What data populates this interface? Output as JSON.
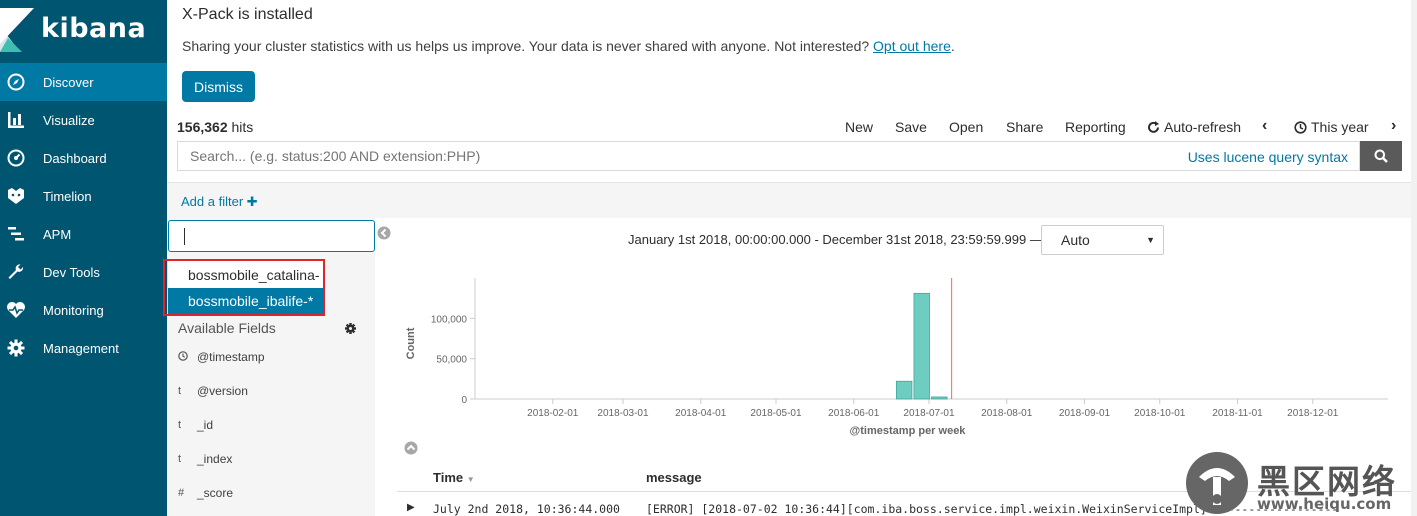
{
  "brand": {
    "name": "kibana"
  },
  "sidebar": {
    "items": [
      {
        "label": "Discover",
        "icon": "compass-icon",
        "active": true
      },
      {
        "label": "Visualize",
        "icon": "bar-chart-icon"
      },
      {
        "label": "Dashboard",
        "icon": "dashboard-icon"
      },
      {
        "label": "Timelion",
        "icon": "timelion-icon"
      },
      {
        "label": "APM",
        "icon": "apm-icon"
      },
      {
        "label": "Dev Tools",
        "icon": "wrench-icon"
      },
      {
        "label": "Monitoring",
        "icon": "heartbeat-icon"
      },
      {
        "label": "Management",
        "icon": "gear-icon"
      }
    ]
  },
  "banner": {
    "title": "X-Pack is installed",
    "text": "Sharing your cluster statistics with us helps us improve. Your data is never shared with anyone. Not interested?",
    "opt_out_link": "Opt out here",
    "text_end": ".",
    "dismiss_label": "Dismiss"
  },
  "hits": {
    "count": "156,362",
    "label": "hits"
  },
  "topmenu": {
    "new": "New",
    "save": "Save",
    "open": "Open",
    "share": "Share",
    "reporting": "Reporting",
    "auto_refresh": "Auto-refresh",
    "time_picker": "This year"
  },
  "search": {
    "placeholder": "Search... (e.g. status:200 AND extension:PHP)",
    "syntax_link": "Uses lucene query syntax"
  },
  "filter": {
    "add_label": "Add a filter"
  },
  "index_pattern": {
    "value": "",
    "options": [
      "bossmobile_catalina-*",
      "bossmobile_ibalife-*"
    ],
    "selected_index": 1
  },
  "fields": {
    "heading": "Available Fields",
    "items": [
      {
        "type": "clock",
        "name": "@timestamp"
      },
      {
        "type": "t",
        "name": "@version"
      },
      {
        "type": "t",
        "name": "_id"
      },
      {
        "type": "t",
        "name": "_index"
      },
      {
        "type": "#",
        "name": "_score"
      }
    ]
  },
  "time_range": {
    "text": "January 1st 2018, 00:00:00.000 - December 31st 2018, 23:59:59.999 —",
    "interval": "Auto"
  },
  "chart_data": {
    "type": "bar",
    "xlabel": "@timestamp per week",
    "ylabel": "Count",
    "ylim": [
      0,
      150000
    ],
    "yticks": [
      "0",
      "50,000",
      "100,000"
    ],
    "ytick_values": [
      0,
      50000,
      100000
    ],
    "xticks": [
      "2018-02-01",
      "2018-03-01",
      "2018-04-01",
      "2018-05-01",
      "2018-06-01",
      "2018-07-01",
      "2018-08-01",
      "2018-09-01",
      "2018-10-01",
      "2018-11-01",
      "2018-12-01"
    ],
    "bars": [
      {
        "week": "2018-06-18",
        "value": 22000
      },
      {
        "week": "2018-06-25",
        "value": 131000
      },
      {
        "week": "2018-07-02",
        "value": 2500
      }
    ],
    "now_marker": "2018-07-10",
    "color": "#6eccc1"
  },
  "table": {
    "headers": {
      "time": "Time",
      "message": "message"
    },
    "rows": [
      {
        "time": "July 2nd 2018, 10:36:44.000",
        "message": "[ERROR] [2018-07-02 10:36:44][com.iba.boss.service.impl.weixin.WeixinServiceImpl]-------------------"
      }
    ]
  },
  "watermark": {
    "text": "黑区网络",
    "url": "www.heiqu.com"
  }
}
